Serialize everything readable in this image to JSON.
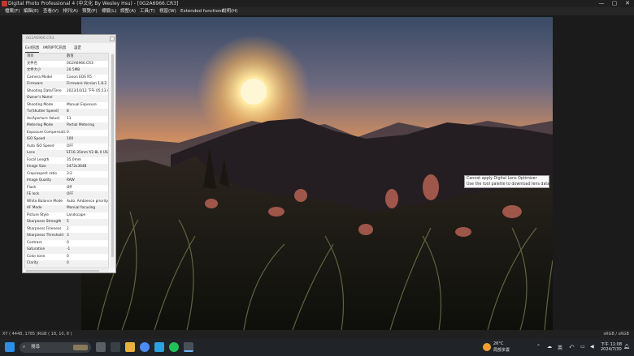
{
  "window": {
    "title": "Digital Photo Professional 4 (中文化 By Wesley Hsu) - [0G2A6966.CR3]",
    "controls": [
      "—",
      "▢",
      "✕"
    ]
  },
  "menu": [
    "檔案(F)",
    "編輯(E)",
    "查看(V)",
    "排列(A)",
    "預覽(P)",
    "標籤(L)",
    "調整(A)",
    "工具(T)",
    "視窗(W)",
    "Extended functions",
    "說明(H)"
  ],
  "info_panel": {
    "title": "0G2A6966.CR3",
    "tabs": [
      "Exif訊息",
      "IM的IPTC訊息",
      "設定"
    ],
    "header": {
      "key": "項目",
      "value": "數值"
    },
    "rows": [
      {
        "key": "文件名",
        "value": "0G2A6966.CR3"
      },
      {
        "key": "文件大小",
        "value": "20.5MB"
      },
      {
        "key": "Camera Model",
        "value": "Canon EOS R5"
      },
      {
        "key": "Firmware",
        "value": "Firmware Version 1.8.2"
      },
      {
        "key": "Shooting Date/Time",
        "value": "2023/10/12 下午 05:13:49"
      },
      {
        "key": "Owner's Name",
        "value": ""
      },
      {
        "key": "Shooting Mode",
        "value": "Manual Exposure"
      },
      {
        "key": "Tv(Shutter Speed)",
        "value": "8"
      },
      {
        "key": "Av(Aperture Value)",
        "value": "11"
      },
      {
        "key": "Metering Mode",
        "value": "Partial Metering"
      },
      {
        "key": "Exposure Compensati...",
        "value": "0"
      },
      {
        "key": "ISO Speed",
        "value": "100"
      },
      {
        "key": "Auto ISO Speed",
        "value": "OFF"
      },
      {
        "key": "Lens",
        "value": "EF16-35mm f/2.8L II USM"
      },
      {
        "key": "Focal Length",
        "value": "35.0mm"
      },
      {
        "key": "Image Size",
        "value": "5472x3648"
      },
      {
        "key": "Crop/aspect ratio",
        "value": "3:2"
      },
      {
        "key": "Image Quality",
        "value": "RAW"
      },
      {
        "key": "Flash",
        "value": "Off"
      },
      {
        "key": "FE lock",
        "value": "OFF"
      },
      {
        "key": "White Balance Mode",
        "value": "Auto: Ambience priority"
      },
      {
        "key": "AF Mode",
        "value": "Manual focusing"
      },
      {
        "key": "Picture Style",
        "value": "Landscape"
      },
      {
        "key": "Sharpness Strength",
        "value": "5"
      },
      {
        "key": "Sharpness Fineness",
        "value": "2"
      },
      {
        "key": "Sharpness Threshold",
        "value": "3"
      },
      {
        "key": "Contrast",
        "value": "0"
      },
      {
        "key": "Saturation",
        "value": "-1"
      },
      {
        "key": "Color tone",
        "value": "0"
      },
      {
        "key": "Clarity",
        "value": "0"
      }
    ]
  },
  "tooltip": {
    "line1": "Cannot apply Digital Lens Optimizer",
    "line2": "Use the tool palette to download lens data."
  },
  "status": {
    "left": "XY ( 4448, 1785 )RGB ( 18, 10, 8 )",
    "right": "sRGB / sRGB"
  },
  "taskbar": {
    "search_placeholder": "搜尋",
    "weather_temp": "26°C",
    "weather_desc": "局部多雲",
    "ime": "英",
    "time": "下午 11:08",
    "date": "2024/7/30"
  }
}
